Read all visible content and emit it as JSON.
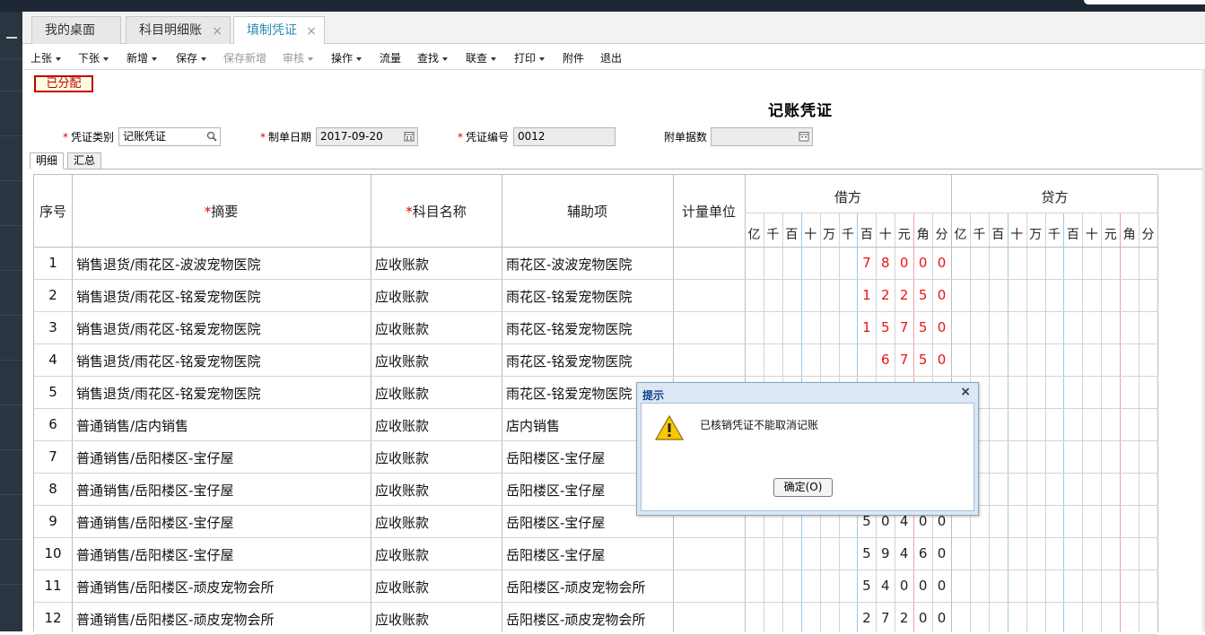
{
  "tabs": [
    {
      "label": "我的桌面",
      "closable": false
    },
    {
      "label": "科目明细账",
      "closable": true
    },
    {
      "label": "填制凭证",
      "closable": true,
      "active": true
    }
  ],
  "tab_close_glyph": "×",
  "toolbar": [
    {
      "label": "上张",
      "dropdown": true
    },
    {
      "label": "下张",
      "dropdown": true
    },
    {
      "label": "新增",
      "dropdown": true
    },
    {
      "label": "保存",
      "dropdown": true
    },
    {
      "label": "保存新增",
      "disabled": true
    },
    {
      "label": "审核",
      "dropdown": true,
      "disabled": true
    },
    {
      "label": "操作",
      "dropdown": true
    },
    {
      "label": "流量"
    },
    {
      "label": "查找",
      "dropdown": true
    },
    {
      "label": "联查",
      "dropdown": true
    },
    {
      "label": "打印",
      "dropdown": true
    },
    {
      "label": "附件"
    },
    {
      "label": "退出"
    }
  ],
  "status_badge": "已分配",
  "voucher_title": "记账凭证",
  "form": {
    "type_label": "凭证类别",
    "type_value": "记账凭证",
    "date_label": "制单日期",
    "date_value": "2017-09-20",
    "no_label": "凭证编号",
    "no_value": "0012",
    "attach_label": "附单据数",
    "attach_value": ""
  },
  "required_star": "*",
  "subtabs": [
    "明细",
    "汇总"
  ],
  "table": {
    "headers": {
      "seq": "序号",
      "summary": "摘要",
      "account": "科目名称",
      "aux": "辅助项",
      "unit": "计量单位",
      "debit": "借方",
      "credit": "贷方"
    },
    "digit_headers": [
      "亿",
      "千",
      "百",
      "十",
      "万",
      "千",
      "百",
      "十",
      "元",
      "角",
      "分"
    ],
    "rows": [
      {
        "seq": "1",
        "summary": "销售退货/雨花区-波波宠物医院",
        "account": "应收账款",
        "aux": "雨花区-波波宠物医院",
        "debit": "78000",
        "red": true
      },
      {
        "seq": "2",
        "summary": "销售退货/雨花区-铭爱宠物医院",
        "account": "应收账款",
        "aux": "雨花区-铭爱宠物医院",
        "debit": "12250",
        "red": true
      },
      {
        "seq": "3",
        "summary": "销售退货/雨花区-铭爱宠物医院",
        "account": "应收账款",
        "aux": "雨花区-铭爱宠物医院",
        "debit": "15750",
        "red": true
      },
      {
        "seq": "4",
        "summary": "销售退货/雨花区-铭爱宠物医院",
        "account": "应收账款",
        "aux": "雨花区-铭爱宠物医院",
        "debit": "6750",
        "red": true
      },
      {
        "seq": "5",
        "summary": "销售退货/雨花区-铭爱宠物医院",
        "account": "应收账款",
        "aux": "雨花区-铭爱宠物医院",
        "debit": "",
        "red": true
      },
      {
        "seq": "6",
        "summary": "普通销售/店内销售",
        "account": "应收账款",
        "aux": "店内销售",
        "debit": "",
        "red": false
      },
      {
        "seq": "7",
        "summary": "普通销售/岳阳楼区-宝仔屋",
        "account": "应收账款",
        "aux": "岳阳楼区-宝仔屋",
        "debit": "",
        "red": false
      },
      {
        "seq": "8",
        "summary": "普通销售/岳阳楼区-宝仔屋",
        "account": "应收账款",
        "aux": "岳阳楼区-宝仔屋",
        "debit": "",
        "red": false
      },
      {
        "seq": "9",
        "summary": "普通销售/岳阳楼区-宝仔屋",
        "account": "应收账款",
        "aux": "岳阳楼区-宝仔屋",
        "debit": "50400",
        "red": false
      },
      {
        "seq": "10",
        "summary": "普通销售/岳阳楼区-宝仔屋",
        "account": "应收账款",
        "aux": "岳阳楼区-宝仔屋",
        "debit": "59460",
        "red": false
      },
      {
        "seq": "11",
        "summary": "普通销售/岳阳楼区-顽皮宠物会所",
        "account": "应收账款",
        "aux": "岳阳楼区-顽皮宠物会所",
        "debit": "54000",
        "red": false
      },
      {
        "seq": "12",
        "summary": "普通销售/岳阳楼区-顽皮宠物会所",
        "account": "应收账款",
        "aux": "岳阳楼区-顽皮宠物会所",
        "debit": "27200",
        "red": false
      }
    ]
  },
  "dialog": {
    "title": "提示",
    "close": "×",
    "message": "已核销凭证不能取消记账",
    "ok_label": "确定(O)",
    "icon": "warning-icon"
  },
  "colors": {
    "accent": "#2a8bb5",
    "red": "#e11111",
    "badge_border": "#c00000"
  }
}
